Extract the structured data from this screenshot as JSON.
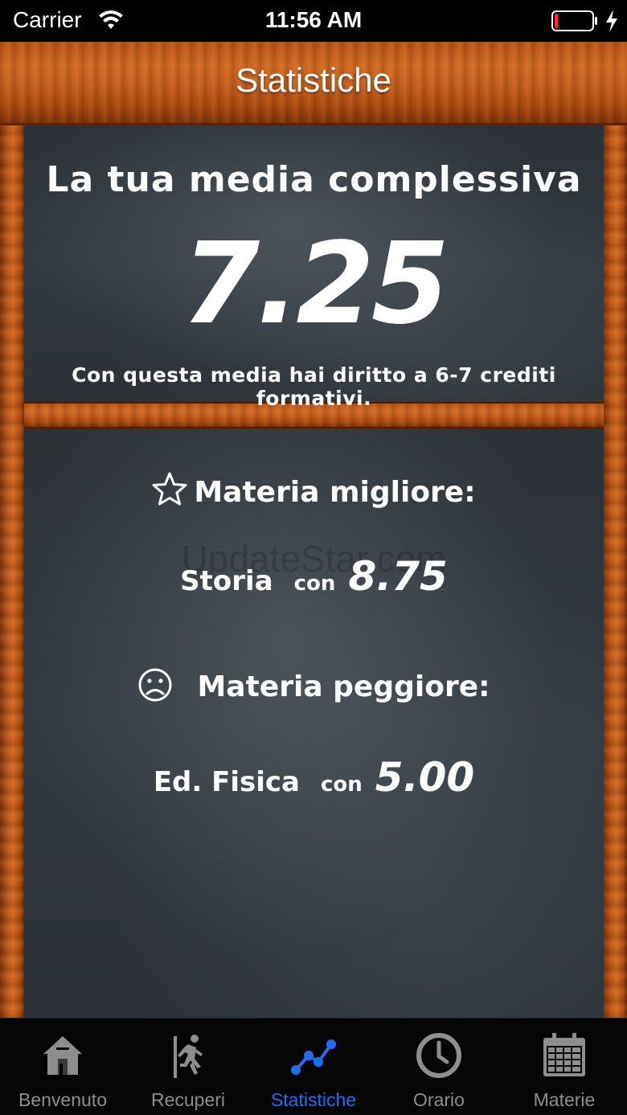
{
  "status_bar": {
    "carrier": "Carrier",
    "time": "11:56 AM",
    "battery_level": 0.1,
    "battery_color": "#ff2d2d"
  },
  "nav": {
    "title": "Statistiche"
  },
  "average": {
    "title": "La tua media complessiva",
    "value": "7.25",
    "note": "Con questa media hai diritto a 6-7 crediti formativi."
  },
  "best": {
    "title": "Materia migliore:",
    "subject": "Storia",
    "con": "con",
    "score": "8.75",
    "icon": "star-outline-icon"
  },
  "worst": {
    "title": "Materia peggiore:",
    "subject": "Ed. Fisica",
    "con": "con",
    "score": "5.00",
    "icon": "sad-face-icon"
  },
  "watermark": "UpdateStar.com",
  "tabs": [
    {
      "label": "Benvenuto",
      "icon": "house-icon",
      "active": false
    },
    {
      "label": "Recuperi",
      "icon": "running-man-icon",
      "active": false
    },
    {
      "label": "Statistiche",
      "icon": "chart-line-icon",
      "active": true
    },
    {
      "label": "Orario",
      "icon": "clock-icon",
      "active": false
    },
    {
      "label": "Materie",
      "icon": "calendar-icon",
      "active": false
    }
  ],
  "colors": {
    "tab_active": "#1e6cf2",
    "tab_inactive": "#8e8e8e"
  }
}
